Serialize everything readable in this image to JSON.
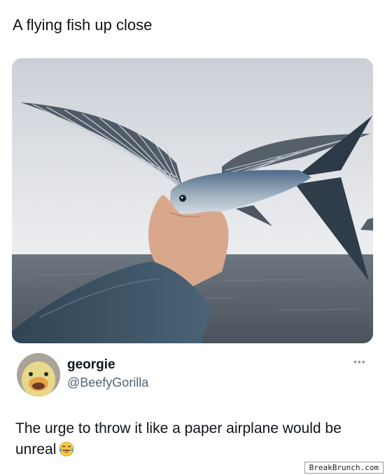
{
  "post": {
    "caption": "A flying fish up close"
  },
  "tweet": {
    "display_name": "georgie",
    "handle": "@BeefyGorilla",
    "text": "The urge to throw it like a paper airplane would be unreal",
    "emoji": "face-with-tears-of-joy",
    "more_icon": "ellipsis-icon",
    "more_glyph": "•••"
  },
  "watermark": {
    "text": "BreakBrunch.com"
  },
  "colors": {
    "handle": "#536471",
    "text": "#0f1419",
    "sky": "#dfe2e7",
    "sea": "#5a6470",
    "sleeve": "#3f5667"
  }
}
